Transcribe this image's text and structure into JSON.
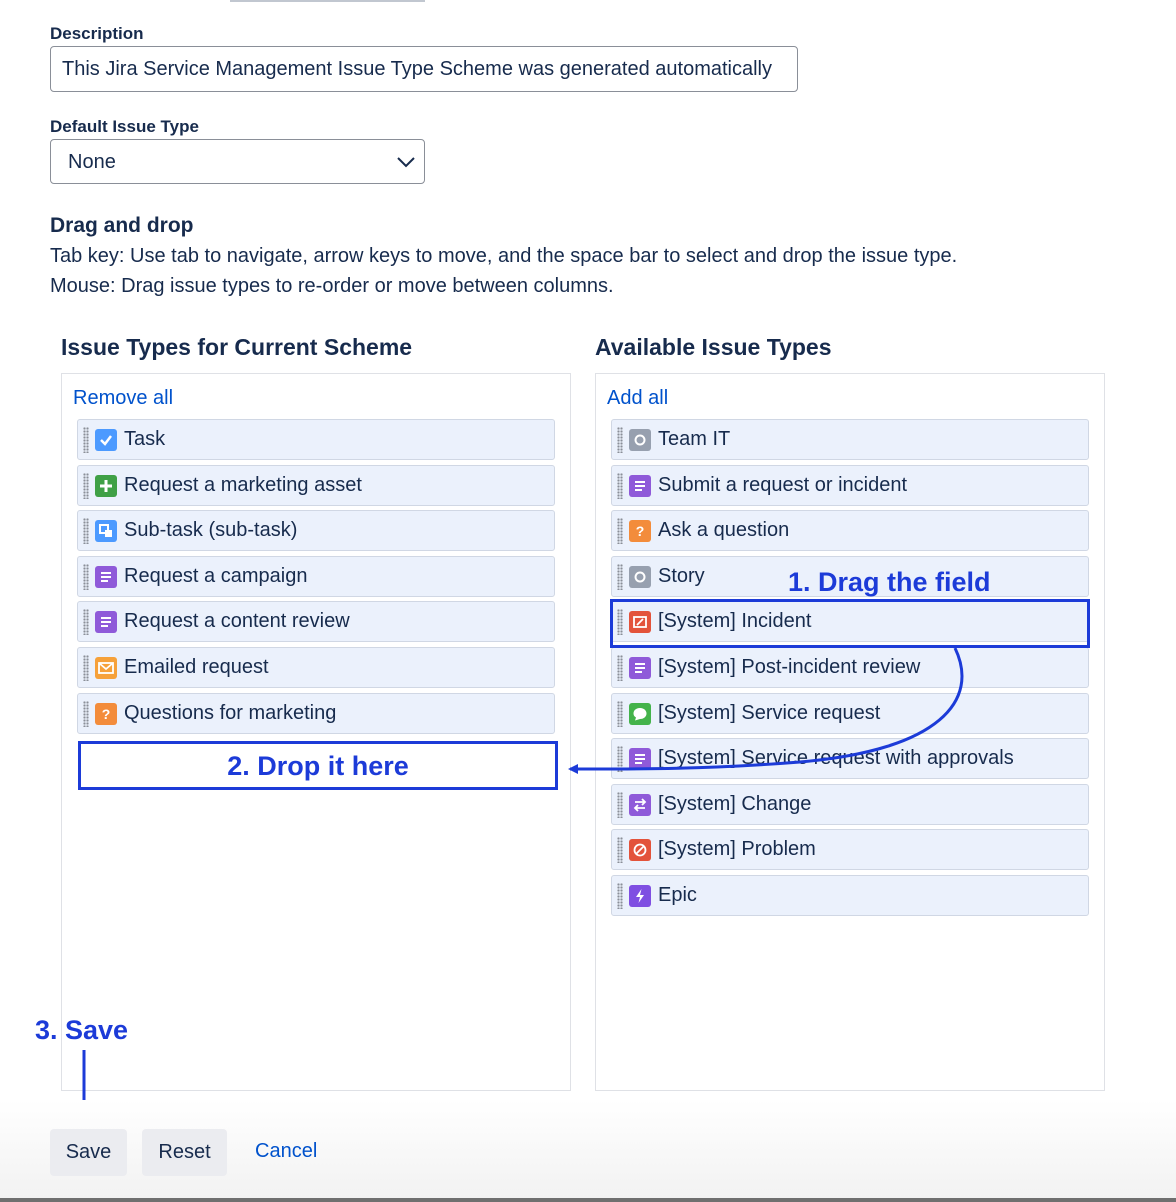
{
  "form": {
    "description_label": "Description",
    "description_value": "This Jira Service Management Issue Type Scheme was generated automatically",
    "default_issue_type_label": "Default Issue Type",
    "default_issue_type_value": "None"
  },
  "drag_drop": {
    "title": "Drag and drop",
    "help_tab": "Tab key: Use tab to navigate, arrow keys to move, and the space bar to select and drop the issue type.",
    "help_mouse": "Mouse: Drag issue types to re-order or move between columns."
  },
  "current_scheme": {
    "heading": "Issue Types for Current Scheme",
    "action_label": "Remove all",
    "items": [
      {
        "name": "Task",
        "icon": "checkbox-icon",
        "color": "#4c9aff"
      },
      {
        "name": "Request a marketing asset",
        "icon": "plus-icon",
        "color": "#3fa046"
      },
      {
        "name": "Sub-task (sub-task)",
        "icon": "subtask-icon",
        "color": "#4c9aff"
      },
      {
        "name": "Request a campaign",
        "icon": "lines-icon",
        "color": "#8f5ad9"
      },
      {
        "name": "Request a content review",
        "icon": "lines-icon",
        "color": "#8f5ad9"
      },
      {
        "name": "Emailed request",
        "icon": "envelope-icon",
        "color": "#f6a13a"
      },
      {
        "name": "Questions for marketing",
        "icon": "question-icon",
        "color": "#f38c3b"
      }
    ]
  },
  "available": {
    "heading": "Available Issue Types",
    "action_label": "Add all",
    "items": [
      {
        "name": "Team IT",
        "icon": "circle-icon",
        "color": "#97a0af"
      },
      {
        "name": "Submit a request or incident",
        "icon": "lines-icon",
        "color": "#8f5ad9"
      },
      {
        "name": "Ask a question",
        "icon": "question-icon",
        "color": "#f38c3b"
      },
      {
        "name": "Story",
        "icon": "circle-icon",
        "color": "#97a0af"
      },
      {
        "name": "[System] Incident",
        "icon": "incident-icon",
        "color": "#e3533b"
      },
      {
        "name": "[System] Post-incident review",
        "icon": "lines-icon",
        "color": "#8f5ad9"
      },
      {
        "name": "[System] Service request",
        "icon": "chat-icon",
        "color": "#44b34b"
      },
      {
        "name": "[System] Service request with approvals",
        "icon": "lines-icon",
        "color": "#8f5ad9"
      },
      {
        "name": "[System] Change",
        "icon": "swap-icon",
        "color": "#8f5ad9"
      },
      {
        "name": "[System] Problem",
        "icon": "no-entry-icon",
        "color": "#e3533b"
      },
      {
        "name": "Epic",
        "icon": "lightning-icon",
        "color": "#7f4fe2"
      }
    ]
  },
  "annotations": {
    "step1": "1. Drag the field",
    "step2": "2. Drop it here",
    "step3": "3. Save",
    "color": "#1c3bd8"
  },
  "actions": {
    "save_label": "Save",
    "reset_label": "Reset",
    "cancel_label": "Cancel"
  }
}
